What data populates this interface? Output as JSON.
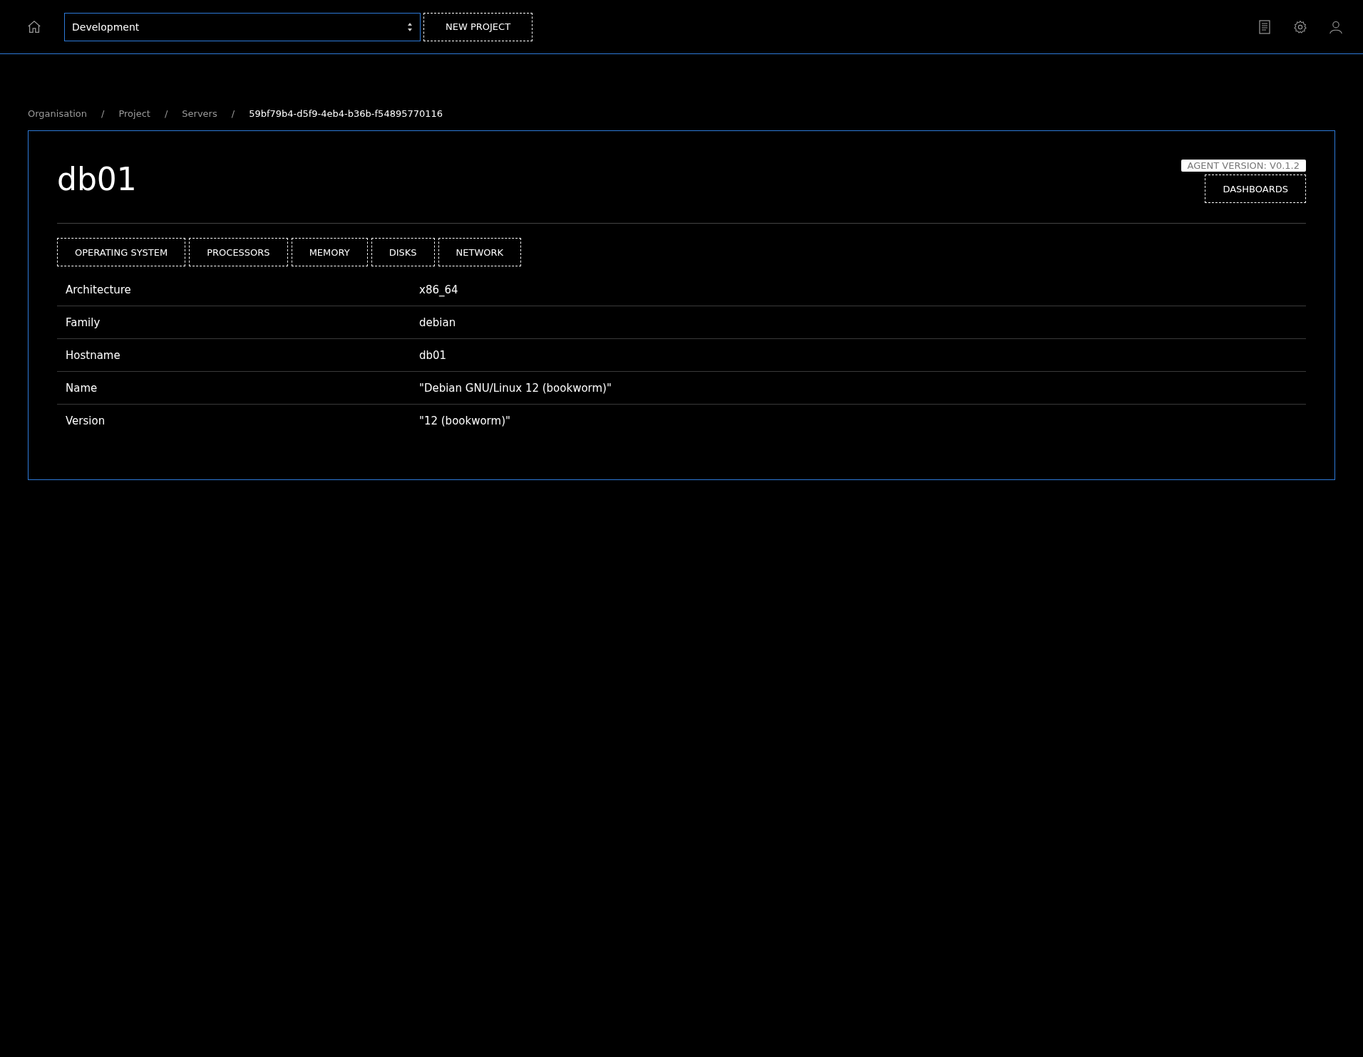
{
  "topbar": {
    "project_select": {
      "value": "Development"
    },
    "new_project_button": "NEW PROJECT"
  },
  "breadcrumb": [
    {
      "label": "Organisation",
      "current": false
    },
    {
      "label": "Project",
      "current": false
    },
    {
      "label": "Servers",
      "current": false
    },
    {
      "label": "59bf79b4-d5f9-4eb4-b36b-f54895770116",
      "current": true
    }
  ],
  "breadcrumb_separator": "/",
  "server": {
    "title": "db01",
    "agent_version": "AGENT VERSION: V0.1.2",
    "dashboards_button": "DASHBOARDS"
  },
  "tabs": [
    {
      "label": "OPERATING SYSTEM"
    },
    {
      "label": "PROCESSORS"
    },
    {
      "label": "MEMORY"
    },
    {
      "label": "DISKS"
    },
    {
      "label": "NETWORK"
    }
  ],
  "table": {
    "rows": [
      {
        "key": "Architecture",
        "value": "x86_64"
      },
      {
        "key": "Family",
        "value": "debian"
      },
      {
        "key": "Hostname",
        "value": "db01"
      },
      {
        "key": "Name",
        "value": "\"Debian GNU/Linux 12 (bookworm)\""
      },
      {
        "key": "Version",
        "value": "\"12 (bookworm)\""
      }
    ]
  }
}
